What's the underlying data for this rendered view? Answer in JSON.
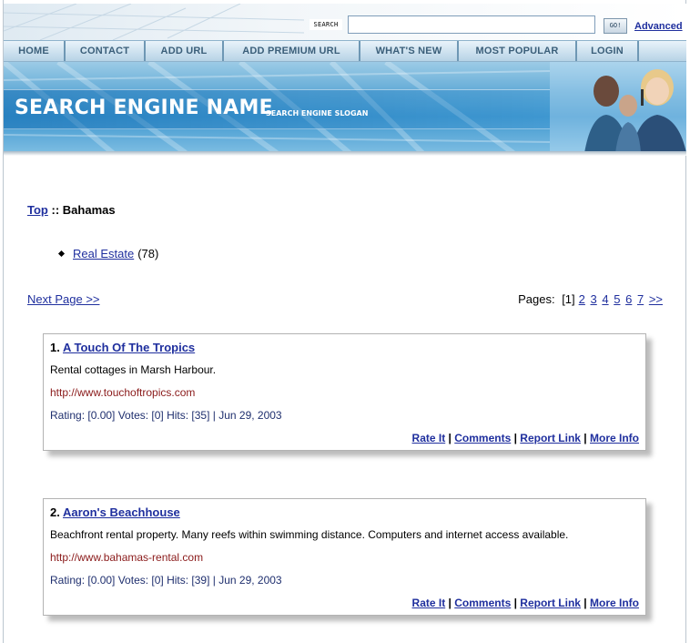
{
  "search": {
    "label": "SEARCH",
    "value": "",
    "go_label": "GO!",
    "advanced_label": "Advanced"
  },
  "nav": {
    "items": [
      {
        "label": "HOME"
      },
      {
        "label": "CONTACT"
      },
      {
        "label": "ADD URL"
      },
      {
        "label": "ADD PREMIUM URL"
      },
      {
        "label": "WHAT'S NEW"
      },
      {
        "label": "MOST POPULAR"
      },
      {
        "label": "LOGIN"
      }
    ]
  },
  "banner": {
    "title": "SEARCH ENGINE NAME",
    "slogan": "SEARCH ENGINE SLOGAN"
  },
  "breadcrumb": {
    "top_label": "Top",
    "separator": "::",
    "current": "Bahamas"
  },
  "category": {
    "label": "Real Estate",
    "count": "(78)"
  },
  "pagination": {
    "next_label": "Next Page >>",
    "pages_label": "Pages:",
    "current": "[1]",
    "pages": [
      "2",
      "3",
      "4",
      "5",
      "6",
      "7"
    ],
    "more_label": ">>"
  },
  "listings": [
    {
      "number": "1.",
      "title": "A Touch Of The Tropics",
      "description": "Rental cottages in Marsh Harbour.",
      "url": "http://www.touchoftropics.com",
      "stats": "Rating: [0.00] Votes: [0] Hits: [35] | Jun 29, 2003",
      "actions": [
        "Rate It",
        "Comments",
        "Report Link",
        "More Info"
      ]
    },
    {
      "number": "2.",
      "title": "Aaron's Beachhouse",
      "description": "Beachfront rental property. Many reefs within swimming distance. Computers and internet access available.",
      "url": "http://www.bahamas-rental.com",
      "stats": "Rating: [0.00] Votes: [0] Hits: [39] | Jun 29, 2003",
      "actions": [
        "Rate It",
        "Comments",
        "Report Link",
        "More Info"
      ]
    }
  ],
  "colors": {
    "link": "#1f2f9e",
    "url": "#8a1a1a",
    "nav_text": "#3b5f7a",
    "banner": "#3f97cf"
  }
}
